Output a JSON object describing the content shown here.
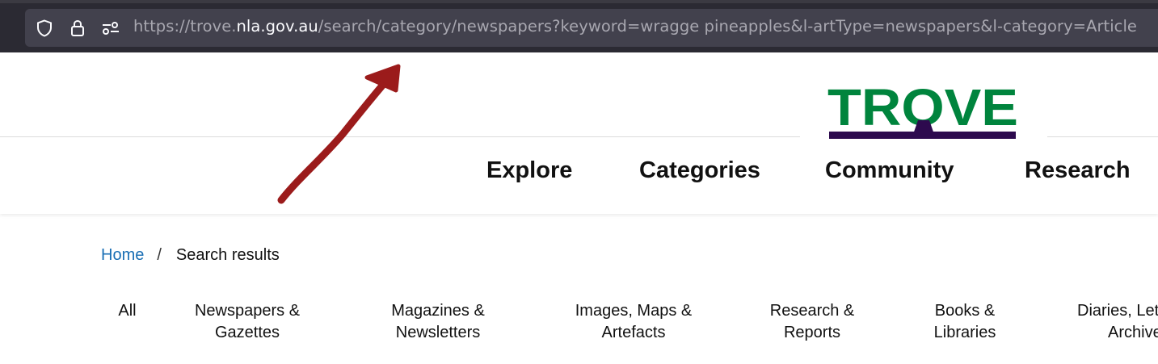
{
  "browser": {
    "url_prefix": "https://trove.",
    "url_host": "nla.gov.au",
    "url_rest": "/search/category/newspapers?keyword=wragge pineapples&l-artType=newspapers&l-category=Article",
    "icons": [
      "shield-icon",
      "lock-icon",
      "page-settings-icon"
    ]
  },
  "header": {
    "logo_text": "TROVE",
    "nav": {
      "explore": "Explore",
      "categories": "Categories",
      "community": "Community",
      "research": "Research"
    }
  },
  "breadcrumb": {
    "home": "Home",
    "separator": "/",
    "current": "Search results"
  },
  "categories": {
    "all": "All",
    "news_line1": "Newspapers &",
    "news_line2": "Gazettes",
    "mags_line1": "Magazines &",
    "mags_line2": "Newsletters",
    "images_line1": "Images, Maps &",
    "images_line2": "Artefacts",
    "research_line1": "Research &",
    "research_line2": "Reports",
    "books_line1": "Books &",
    "books_line2": "Libraries",
    "diaries_line1": "Diaries, Let",
    "diaries_line2": "Archive"
  },
  "colors": {
    "logo_green": "#00843d",
    "logo_purple": "#2d0a4e",
    "link_blue": "#1a6fb5",
    "annotation_red": "#9b1b1b"
  }
}
